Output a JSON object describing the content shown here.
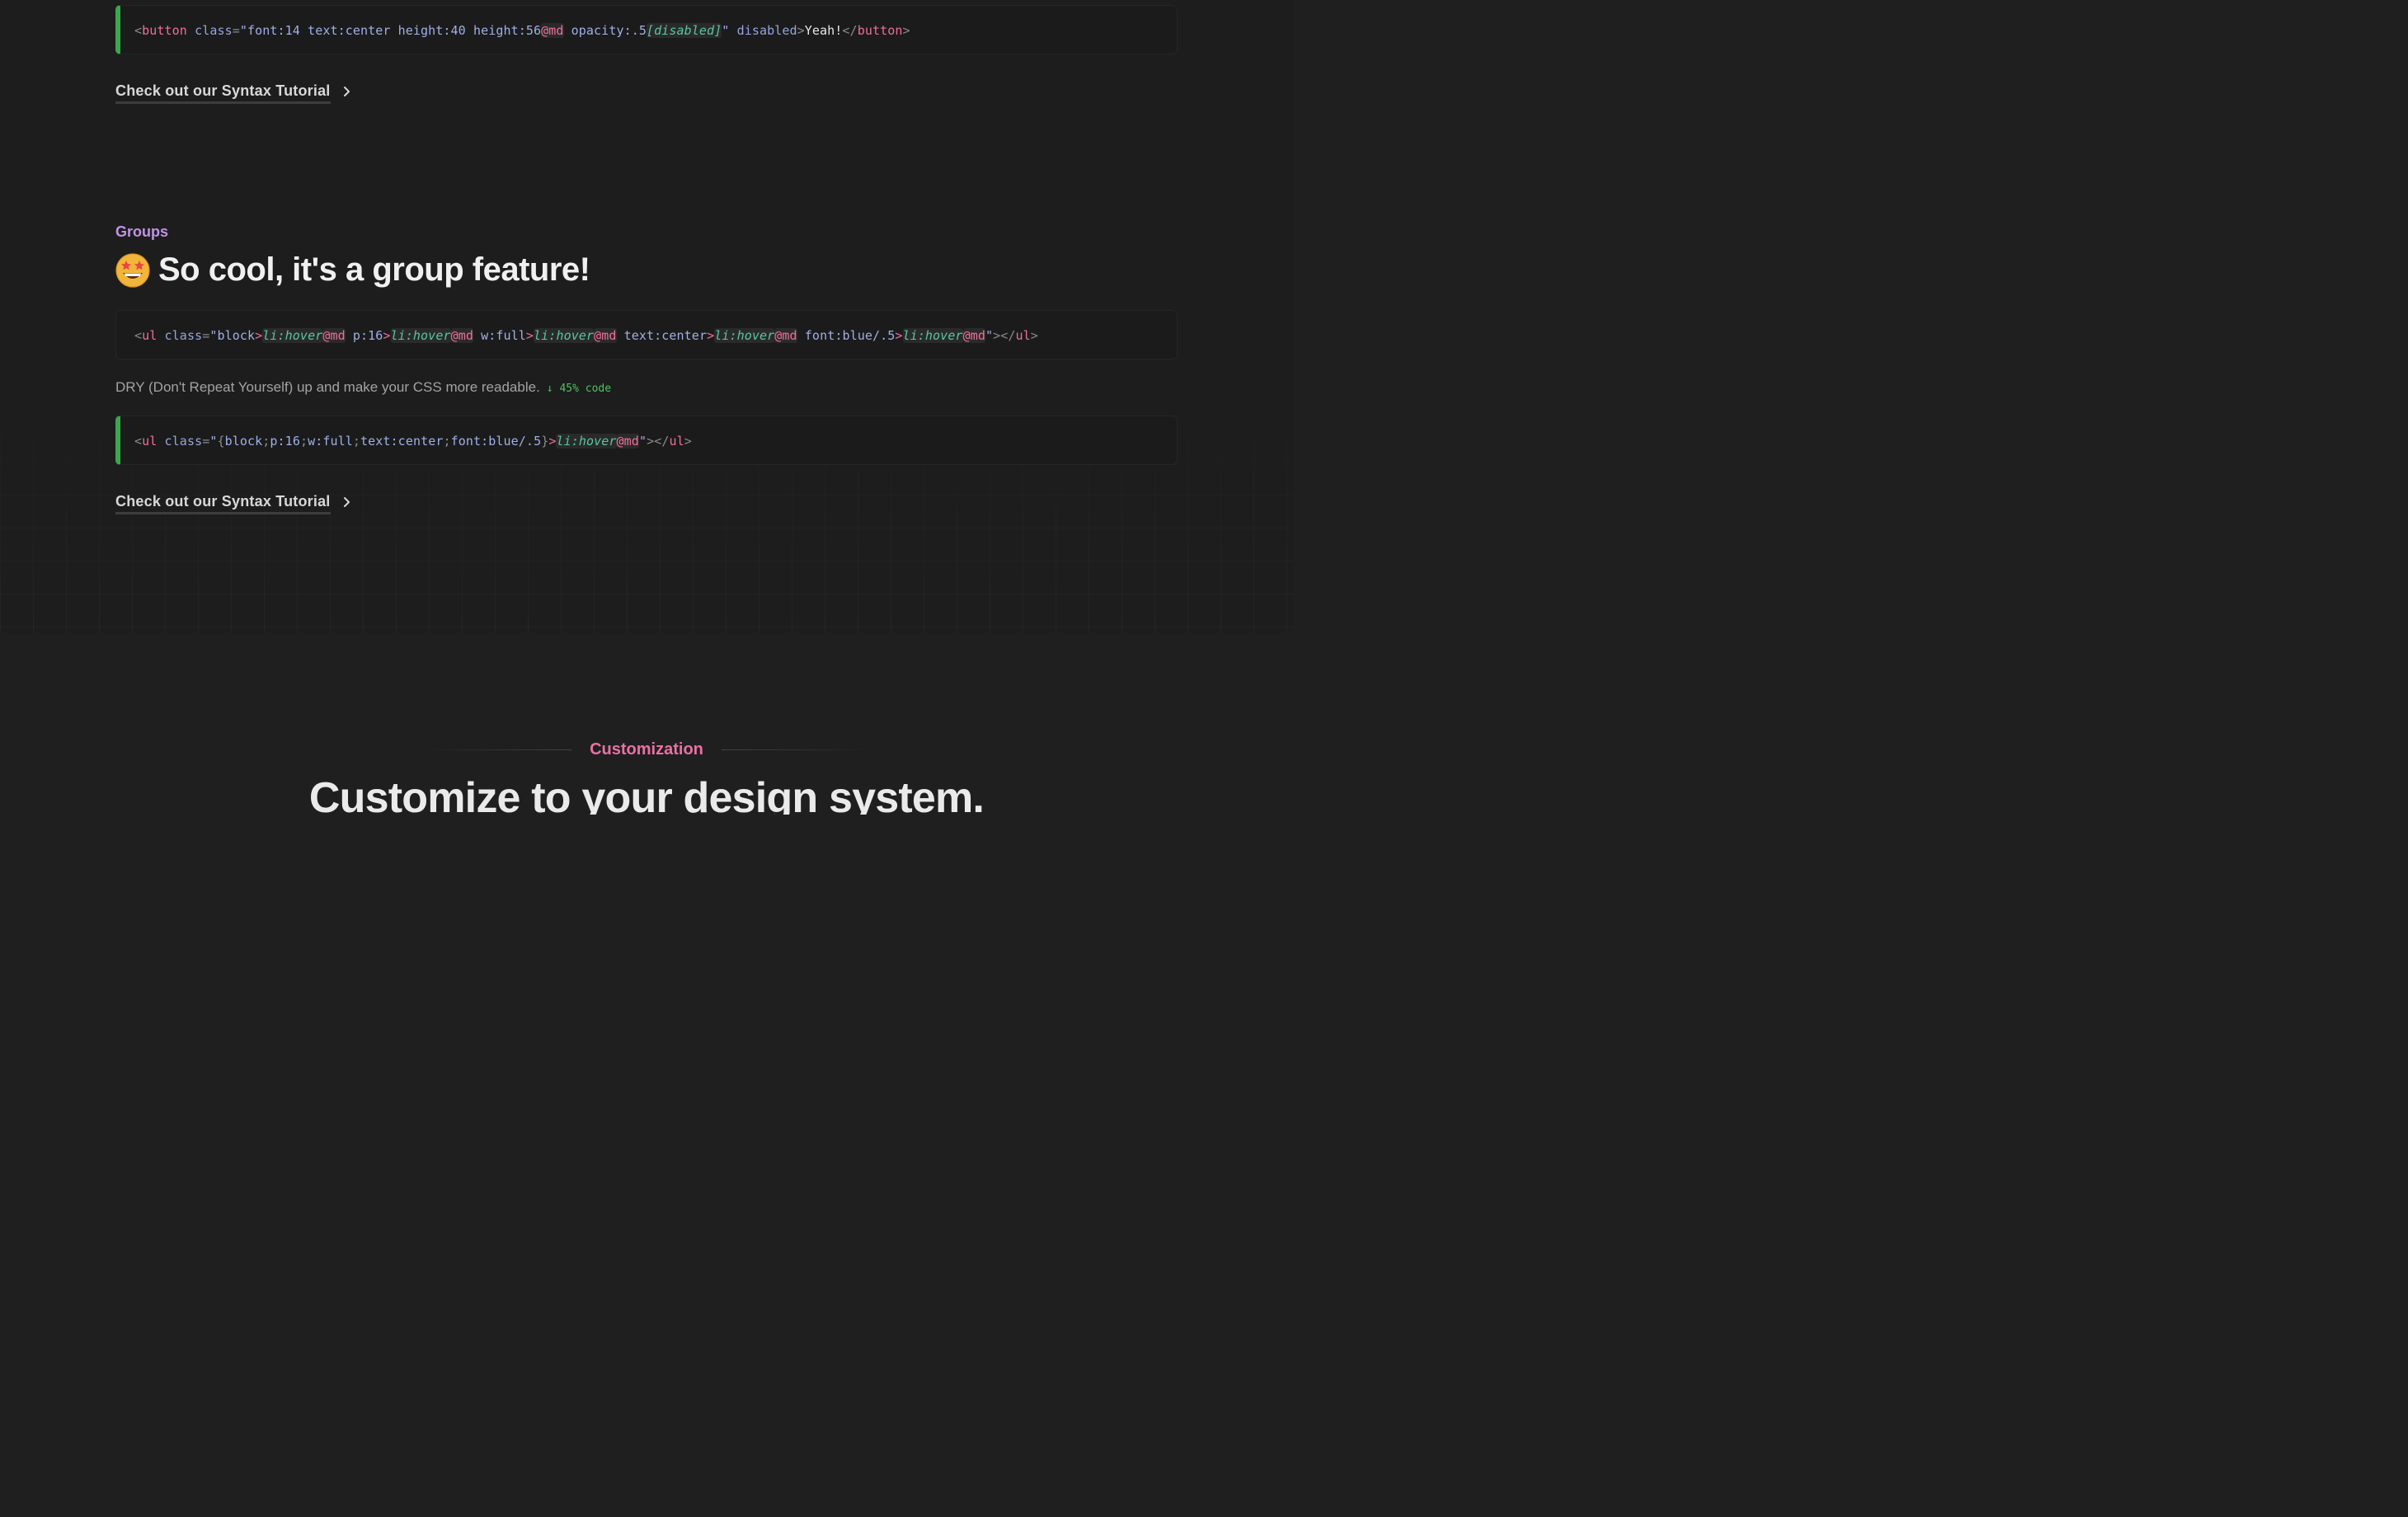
{
  "code_button": {
    "lt": "<",
    "tag": "button",
    "attr": "class",
    "eq": "=",
    "q": "\"",
    "c1": "font:14 text:center height:40 height:56",
    "at1": "@md",
    "c2": " opacity:.5",
    "sel": "[disabled]",
    "attr2": "disabled",
    "gt": ">",
    "text": "Yeah!",
    "close": "</",
    "closetag": "button"
  },
  "link_label": "Check out our Syntax Tutorial",
  "groups": {
    "eyebrow": "Groups",
    "title": "So cool, it's a group feature!",
    "emoji_name": "star-struck-emoji-icon",
    "description": "DRY (Don't Repeat Yourself) up and make your CSS more readable.",
    "badge": "↓ 45% code"
  },
  "code_ul1": {
    "lt": "<",
    "tag": "ul",
    "attr": "class",
    "eq": "=",
    "q": "\"",
    "v1": "block",
    "v2": " p:16",
    "v3": " w:full",
    "v4": " text:center",
    "v5": " font:blue/.5",
    "chev": ">",
    "sel": "li:hover",
    "at": "@md",
    "gt": ">",
    "close": "</",
    "closetag": "ul"
  },
  "code_ul2": {
    "lt": "<",
    "tag": "ul",
    "attr": "class",
    "eq": "=",
    "q": "\"",
    "open": "{",
    "semi": ";",
    "v1": "block",
    "v2": "p:16",
    "v3": "w:full",
    "v4": "text:center",
    "v5": "font:blue/.5",
    "cb": "}",
    "chev": ">",
    "sel": "li:hover",
    "at": "@md",
    "gt": ">",
    "close": "</",
    "closetag": "ul"
  },
  "customization": {
    "eyebrow": "Customization",
    "title": "Customize to your design system."
  },
  "colors": {
    "background": "#1f1f1f",
    "accent_green": "#39a84d",
    "groups_purple": "#c193e8",
    "customization_pink": "#ea71a5"
  }
}
